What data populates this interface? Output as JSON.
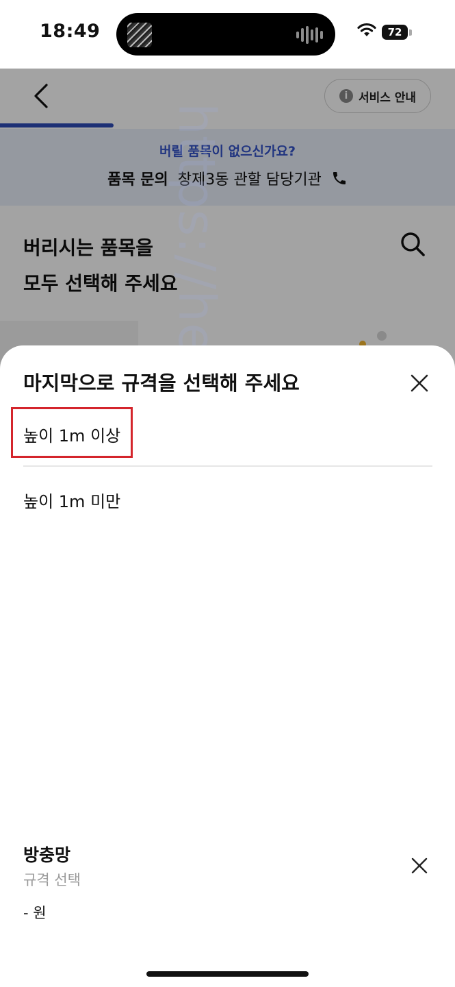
{
  "status_bar": {
    "time": "18:49",
    "battery": "72"
  },
  "background_page": {
    "service_button": "서비스 안내",
    "notice": {
      "question": "버릴 품목이 없으신가요?",
      "label": "품목 문의",
      "value": "창제3동 관할 담당기관"
    },
    "title_line1": "버리시는 품목을",
    "title_line2": "모두 선택해 주세요"
  },
  "sheet": {
    "title": "마지막으로 규격을 선택해 주세요",
    "options": [
      {
        "label": "높이 1m 이상",
        "highlighted": true
      },
      {
        "label": "높이 1m 미만",
        "highlighted": false
      }
    ],
    "selected_item": {
      "name": "방충망",
      "subtitle": "규격 선택",
      "price": "- 원"
    }
  },
  "watermark": "https://heal-you.tistory.com",
  "colors": {
    "accent": "#2e4bb8",
    "highlight_border": "#d4252c",
    "notice_bg": "#eaf0fb"
  }
}
